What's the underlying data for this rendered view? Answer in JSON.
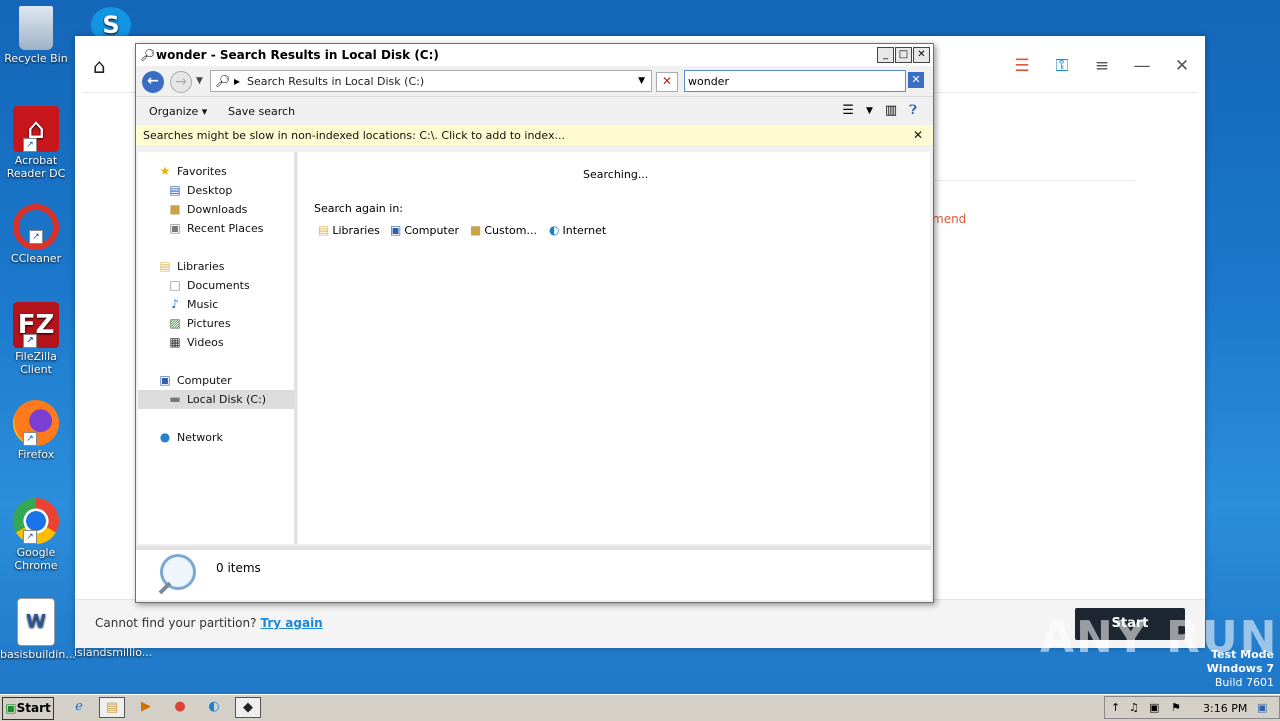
{
  "desktop": {
    "icons": [
      {
        "label": "Recycle Bin",
        "icon": "recycle-bin-icon"
      },
      {
        "label": "Acrobat Reader DC",
        "icon": "acrobat-icon"
      },
      {
        "label": "CCleaner",
        "icon": "ccleaner-icon"
      },
      {
        "label": "FileZilla Client",
        "icon": "filezilla-icon"
      },
      {
        "label": "Firefox",
        "icon": "firefox-icon"
      },
      {
        "label": "Google Chrome",
        "icon": "chrome-icon"
      },
      {
        "label": "basisbuildin...",
        "icon": "word-document-icon"
      },
      {
        "label": "islandsmillio...",
        "icon": "document-icon"
      }
    ]
  },
  "app": {
    "recommend_text": "mend",
    "cannot_find_text": "Cannot find your partition?",
    "try_again_link": "Try again",
    "start_button": "Start"
  },
  "explorer": {
    "title": "wonder - Search Results in Local Disk (C:)",
    "address": "Search Results in Local Disk (C:)",
    "search_value": "wonder",
    "toolbar": {
      "organize": "Organize",
      "save_search": "Save search"
    },
    "infobar_text": "Searches might be slow in non-indexed locations: C:\\. Click to add to index...",
    "nav": {
      "favorites": "Favorites",
      "desktop": "Desktop",
      "downloads": "Downloads",
      "recent_places": "Recent Places",
      "libraries": "Libraries",
      "documents": "Documents",
      "music": "Music",
      "pictures": "Pictures",
      "videos": "Videos",
      "computer": "Computer",
      "local_disk": "Local Disk (C:)",
      "network": "Network"
    },
    "content": {
      "searching": "Searching...",
      "search_again": "Search again in:",
      "locations": [
        "Libraries",
        "Computer",
        "Custom...",
        "Internet"
      ]
    },
    "details": {
      "count": "0 items"
    }
  },
  "watermark": "ANY RUN",
  "test_mode": {
    "line1": "Test Mode",
    "line2": "Windows 7",
    "line3": "Build 7601"
  },
  "taskbar": {
    "start": "Start",
    "clock": "3:16 PM"
  },
  "colors": {
    "accent": "#e05a3a",
    "link": "#1a8ad6",
    "desktop": "#1b78cc"
  }
}
